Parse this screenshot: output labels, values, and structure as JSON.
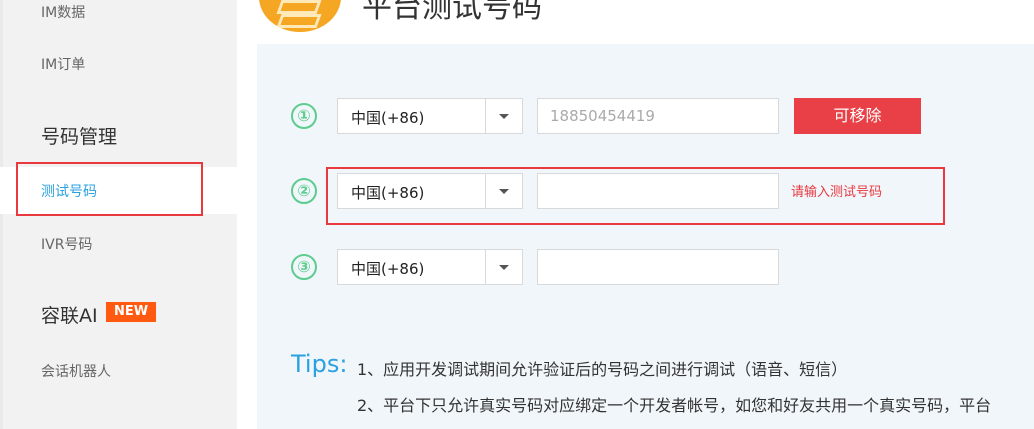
{
  "sidebar": {
    "items": {
      "im_data": "IM数据",
      "im_order": "IM订单",
      "number_mgmt": "号码管理",
      "test_number": "测试号码",
      "ivr_number": "IVR号码",
      "ronglian_ai": "容联AI",
      "chatbot": "会话机器人"
    },
    "new_badge": "NEW"
  },
  "header": {
    "title": "平台测试号码"
  },
  "rows": [
    {
      "index": "①",
      "country": "中国(+86)",
      "phone": "18850454419",
      "action": "可移除"
    },
    {
      "index": "②",
      "country": "中国(+86)",
      "phone": "",
      "error": "请输入测试号码"
    },
    {
      "index": "③",
      "country": "中国(+86)",
      "phone": ""
    }
  ],
  "tips": {
    "label": "Tips:",
    "line1": "1、应用开发调试期间允许验证后的号码之间进行调试（语音、短信）",
    "line2": "2、平台下只允许真实号码对应绑定一个开发者帐号，如您和好友共用一个真实号码，平台"
  },
  "colors": {
    "accent_blue": "#2aa1e0",
    "danger_red": "#e84046",
    "step_green": "#5dcc8f",
    "new_orange": "#ff5a10",
    "panel_bg": "#f1f6fb"
  }
}
